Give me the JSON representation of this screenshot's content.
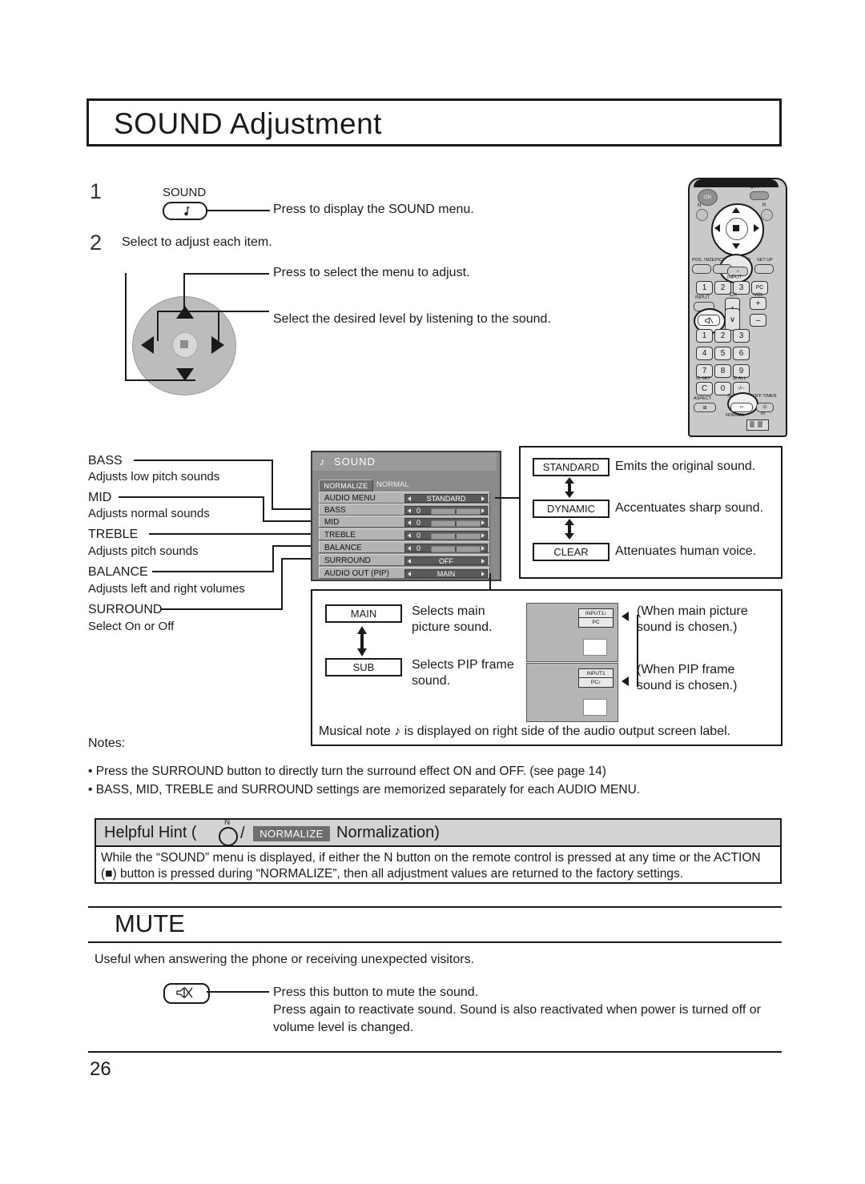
{
  "page": {
    "title": "SOUND Adjustment",
    "number": "26"
  },
  "steps": {
    "one": {
      "num": "1",
      "button_label": "SOUND",
      "button_icon": "musical-note",
      "description": "Press to display the SOUND menu."
    },
    "two": {
      "num": "2",
      "heading": "Select to adjust each item.",
      "up_down_desc": "Press to select the menu to adjust.",
      "left_right_desc": "Select the desired level by listening to the sound."
    }
  },
  "remote": {
    "on": "ON",
    "off": "OFF",
    "n": "N",
    "r": "R",
    "pos_size": "POS. /SIZE",
    "picture": "PICTURE",
    "sound": "SOUND",
    "setup": "SET UP",
    "input_group": "INPUT",
    "input_keys": [
      "1",
      "2",
      "3",
      "PC"
    ],
    "input": "INPUT",
    "ch": "CH",
    "vol": "VOL",
    "vol_plus": "+",
    "vol_minus": "–",
    "ch_up": "∧",
    "ch_down": "∨",
    "numbers": [
      "1",
      "2",
      "3",
      "4",
      "5",
      "6",
      "7",
      "8",
      "9",
      "C",
      "0",
      "-/--"
    ],
    "id_set": "ID SET",
    "id_all": "ID ALL",
    "aspect": "ASPECT",
    "surround": "SURROUND",
    "off_timer": "OFF TIMER",
    "normal": "NORMAL",
    "id": "ID"
  },
  "osd": {
    "title": "SOUND",
    "note_icon": "musical-note",
    "normalize_button": "NORMALIZE",
    "normalize_value": "NORMAL",
    "rows": [
      {
        "name": "AUDIO MENU",
        "type": "value",
        "value": "STANDARD"
      },
      {
        "name": "BASS",
        "type": "slider",
        "value": "0"
      },
      {
        "name": "MID",
        "type": "slider",
        "value": "0"
      },
      {
        "name": "TREBLE",
        "type": "slider",
        "value": "0"
      },
      {
        "name": "BALANCE",
        "type": "slider",
        "value": "0"
      },
      {
        "name": "SURROUND",
        "type": "value",
        "value": "OFF"
      },
      {
        "name": "AUDIO OUT (PIP)",
        "type": "value",
        "value": "MAIN"
      }
    ]
  },
  "left_labels": [
    {
      "title": "BASS",
      "desc": "Adjusts low pitch sounds"
    },
    {
      "title": "MID",
      "desc": "Adjusts normal sounds"
    },
    {
      "title": "TREBLE",
      "desc": "Adjusts pitch sounds"
    },
    {
      "title": "BALANCE",
      "desc": "Adjusts left and right volumes"
    },
    {
      "title": "SURROUND",
      "desc": "Select On or Off"
    }
  ],
  "audio_menu_box": {
    "items": [
      {
        "tag": "STANDARD",
        "desc": "Emits the original sound."
      },
      {
        "tag": "DYNAMIC",
        "desc": "Accentuates sharp sound."
      },
      {
        "tag": "CLEAR",
        "desc": "Attenuates human voice."
      }
    ]
  },
  "pip_box": {
    "items": [
      {
        "tag": "MAIN",
        "desc_line1": "Selects main",
        "desc_line2": "picture sound.",
        "note_line1": "(When main picture",
        "note_line2": "sound is chosen.)",
        "screen_label_top": "INPUT1",
        "screen_label_bottom": "PC",
        "note_on": "top"
      },
      {
        "tag": "SUB",
        "desc_line1": "Selects PIP frame",
        "desc_line2": "sound.",
        "note_line1": "(When PIP frame",
        "note_line2": "sound is chosen.)",
        "screen_label_top": "INPUT1",
        "screen_label_bottom": "PC",
        "note_on": "bottom"
      }
    ],
    "footer": "Musical note ♪ is displayed on right side of the audio output screen label."
  },
  "notes": {
    "title": "Notes:",
    "items": [
      "• Press the SURROUND button to directly turn the surround effect ON and OFF. (see page 14)",
      "• BASS, MID, TREBLE and SURROUND settings are memorized separately for each AUDIO MENU."
    ]
  },
  "helpful_hint": {
    "prefix": "Helpful Hint (",
    "n_label": "N",
    "slash": "/",
    "normalize_tag": "NORMALIZE",
    "suffix": "Normalization)",
    "body_line1": "While the “SOUND” menu is displayed, if either the N button on the remote control is pressed at any time or the ACTION",
    "body_line2": "(■) button is pressed during “NORMALIZE”, then all adjustment values are returned to the factory settings."
  },
  "mute": {
    "title": "MUTE",
    "intro": "Useful when answering the phone or receiving unexpected visitors.",
    "button_icon": "mute-speaker",
    "line1": "Press this button to mute the sound.",
    "line2": "Press again to reactivate sound. Sound is also reactivated when power is turned off or",
    "line3": "volume level is changed."
  },
  "colors": {
    "ink": "#1a1a1a",
    "osd_panel": "#8a8a8a",
    "osd_row": "#b3b3b3",
    "osd_control": "#5a5a5a",
    "hint_header": "#d3d3d3",
    "normalize_tag": "#6e6e6e",
    "screen_gray": "#b5b5b5"
  }
}
